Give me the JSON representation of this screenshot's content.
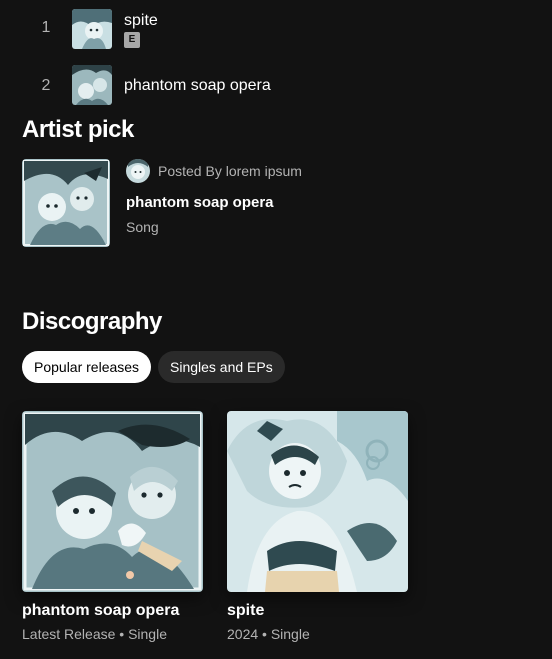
{
  "tracks": [
    {
      "number": "1",
      "title": "spite",
      "explicit_badge": "E"
    },
    {
      "number": "2",
      "title": "phantom soap opera"
    }
  ],
  "artist_pick": {
    "heading": "Artist pick",
    "posted_by": "Posted By lorem ipsum",
    "title": "phantom soap opera",
    "type": "Song"
  },
  "discography": {
    "heading": "Discography",
    "filters": [
      "Popular releases",
      "Singles and EPs"
    ],
    "releases": [
      {
        "title": "phantom soap opera",
        "subtitle": "Latest Release • Single"
      },
      {
        "title": "spite",
        "subtitle": "2024 • Single"
      }
    ]
  },
  "colors": {
    "background": "#121212",
    "text_primary": "#ffffff",
    "text_secondary": "#b3b3b3",
    "chip_active_bg": "#ffffff",
    "chip_inactive_bg": "#2a2a2a"
  }
}
